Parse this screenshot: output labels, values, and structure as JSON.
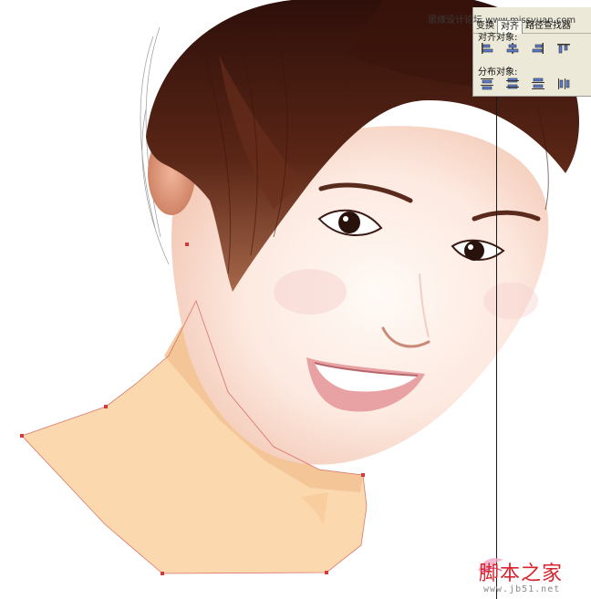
{
  "panel": {
    "title": "思缘设计论坛 www.missyuan.com",
    "tabs": [
      "变换",
      "对齐",
      "路径查找器"
    ],
    "align_label": "对齐对象:",
    "distribute_label": "分布对象:",
    "align_buttons": [
      "align-left-icon",
      "align-horizontal-center-icon",
      "align-right-icon",
      "align-top-icon"
    ],
    "distribute_buttons": [
      "distribute-top-icon",
      "distribute-vertical-center-icon",
      "distribute-bottom-icon",
      "distribute-left-icon"
    ]
  },
  "watermark": {
    "text": "脚本之家",
    "url": "www.jb51.net"
  },
  "colors": {
    "skin_fill": "#fbd8ad",
    "hair": "#4a1d12",
    "path_anchor": "#d23a3a",
    "guide": "#1a1a1a",
    "panel_bg": "#ece9d8"
  }
}
